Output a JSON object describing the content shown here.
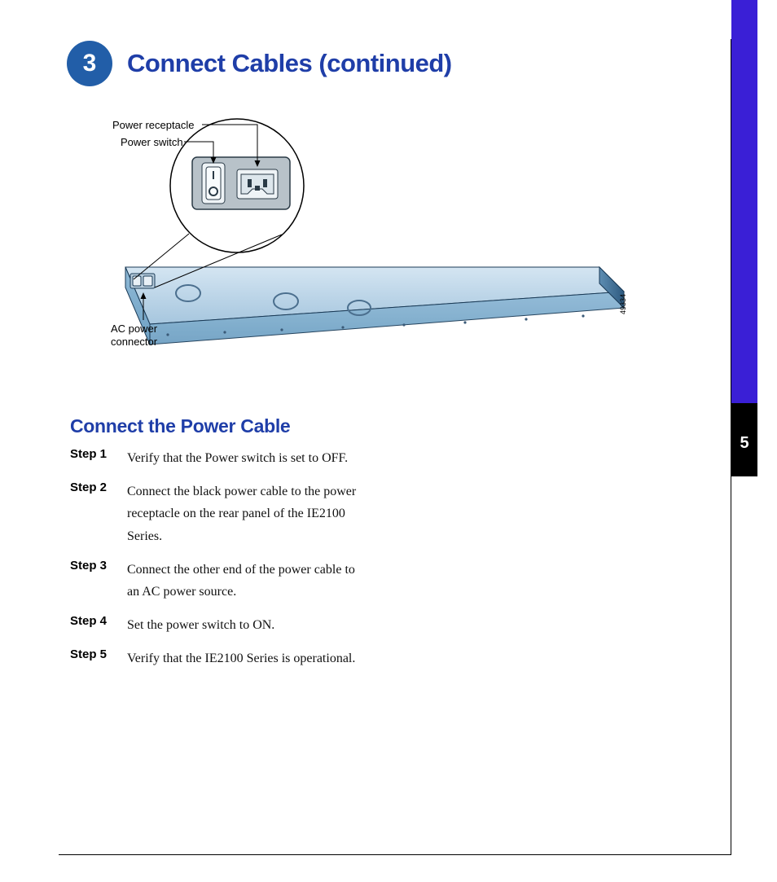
{
  "page_number_tab": "5",
  "header": {
    "badge_number": "3",
    "title": "Connect Cables (continued)"
  },
  "diagram": {
    "figure_number": "49334",
    "labels": {
      "power_receptacle": "Power receptacle",
      "power_switch": "Power switch",
      "ac_power_connector": "AC power\nconnector"
    }
  },
  "section": {
    "subheading": "Connect the Power Cable",
    "steps": [
      {
        "label": "Step 1",
        "text": "Verify that the Power switch is set to OFF."
      },
      {
        "label": "Step 2",
        "text": "Connect the black power cable to the power receptacle on the rear panel of the IE2100 Series."
      },
      {
        "label": "Step 3",
        "text": "Connect the other end of the power cable to an AC power source."
      },
      {
        "label": "Step 4",
        "text": "Set the power switch to ON."
      },
      {
        "label": "Step 5",
        "text": "Verify that the IE2100 Series is operational."
      }
    ]
  }
}
